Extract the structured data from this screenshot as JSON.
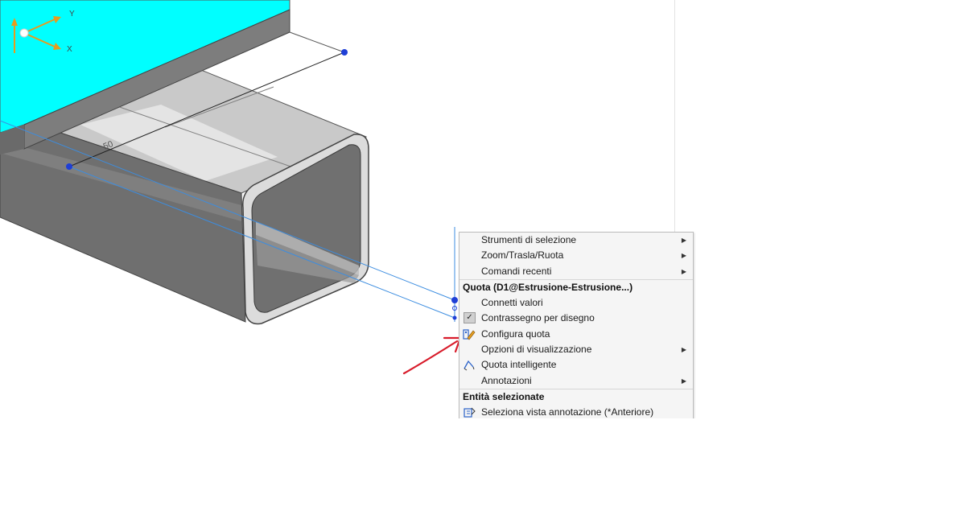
{
  "triad": {
    "y_label": "Y",
    "x_label": "X"
  },
  "model": {
    "dimension_text": "50"
  },
  "colors": {
    "plate": "#00ffff",
    "tube_face": "#6e6e6e",
    "dim_line": "#3c8de0",
    "arrow": "#d81c2b"
  },
  "context_menu": {
    "items": [
      {
        "label": "Strumenti di selezione",
        "submenu": true
      },
      {
        "label": "Zoom/Trasla/Ruota",
        "submenu": true
      },
      {
        "label": "Comandi recenti",
        "submenu": true
      }
    ],
    "section1_header": "Quota (D1@Estrusione-Estrusione...)",
    "section1_items": [
      {
        "label": "Connetti valori",
        "icon": "none"
      },
      {
        "label": "Contrassegno per disegno",
        "icon": "checkbox-checked"
      },
      {
        "label": "Configura quota",
        "icon": "configure-dimension-icon"
      },
      {
        "label": "Opzioni di visualizzazione",
        "submenu": true
      },
      {
        "label": "Quota intelligente",
        "icon": "smart-dimension-icon"
      },
      {
        "label": "Annotazioni",
        "submenu": true
      }
    ],
    "section2_header": "Entità selezionate",
    "section2_items": [
      {
        "label": "Seleziona vista annotazione (*Anteriore)",
        "icon": "annotation-view-icon"
      }
    ]
  }
}
